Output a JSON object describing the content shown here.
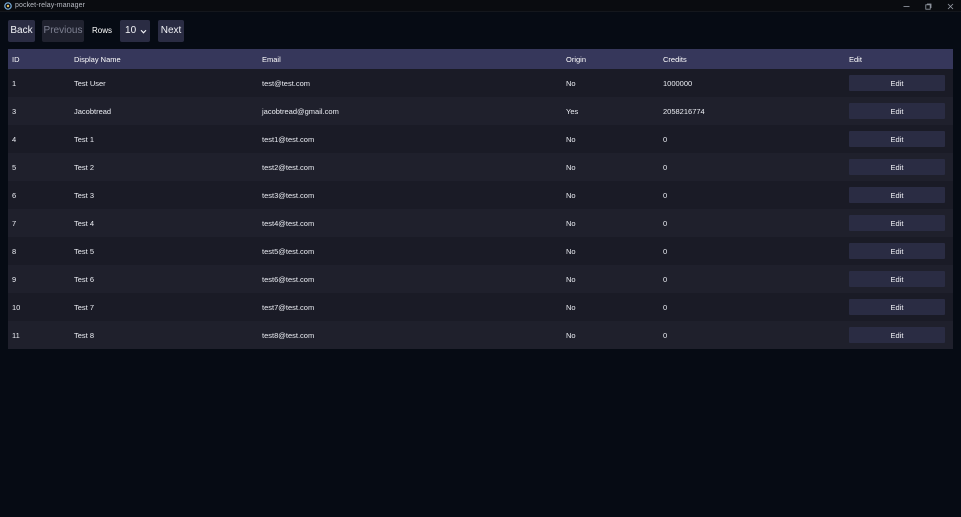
{
  "window": {
    "title": "pocket-relay-manager",
    "controls": [
      "minimize-icon",
      "restore-icon",
      "close-icon"
    ]
  },
  "toolbar": {
    "back_label": "Back",
    "previous_label": "Previous",
    "rows_label": "Rows",
    "rows_value": "10",
    "next_label": "Next"
  },
  "table": {
    "headers": {
      "id": "ID",
      "name": "Display Name",
      "email": "Email",
      "origin": "Origin",
      "credits": "Credits",
      "edit": "Edit"
    },
    "rows": [
      {
        "id": "1",
        "name": "Test User",
        "email": "test@test.com",
        "origin": "No",
        "credits": "1000000",
        "edit": "Edit"
      },
      {
        "id": "3",
        "name": "Jacobtread",
        "email": "jacobtread@gmail.com",
        "origin": "Yes",
        "credits": "2058216774",
        "edit": "Edit"
      },
      {
        "id": "4",
        "name": "Test 1",
        "email": "test1@test.com",
        "origin": "No",
        "credits": "0",
        "edit": "Edit"
      },
      {
        "id": "5",
        "name": "Test 2",
        "email": "test2@test.com",
        "origin": "No",
        "credits": "0",
        "edit": "Edit"
      },
      {
        "id": "6",
        "name": "Test 3",
        "email": "test3@test.com",
        "origin": "No",
        "credits": "0",
        "edit": "Edit"
      },
      {
        "id": "7",
        "name": "Test 4",
        "email": "test4@test.com",
        "origin": "No",
        "credits": "0",
        "edit": "Edit"
      },
      {
        "id": "8",
        "name": "Test 5",
        "email": "test5@test.com",
        "origin": "No",
        "credits": "0",
        "edit": "Edit"
      },
      {
        "id": "9",
        "name": "Test 6",
        "email": "test6@test.com",
        "origin": "No",
        "credits": "0",
        "edit": "Edit"
      },
      {
        "id": "10",
        "name": "Test 7",
        "email": "test7@test.com",
        "origin": "No",
        "credits": "0",
        "edit": "Edit"
      },
      {
        "id": "11",
        "name": "Test 8",
        "email": "test8@test.com",
        "origin": "No",
        "credits": "0",
        "edit": "Edit"
      }
    ]
  }
}
